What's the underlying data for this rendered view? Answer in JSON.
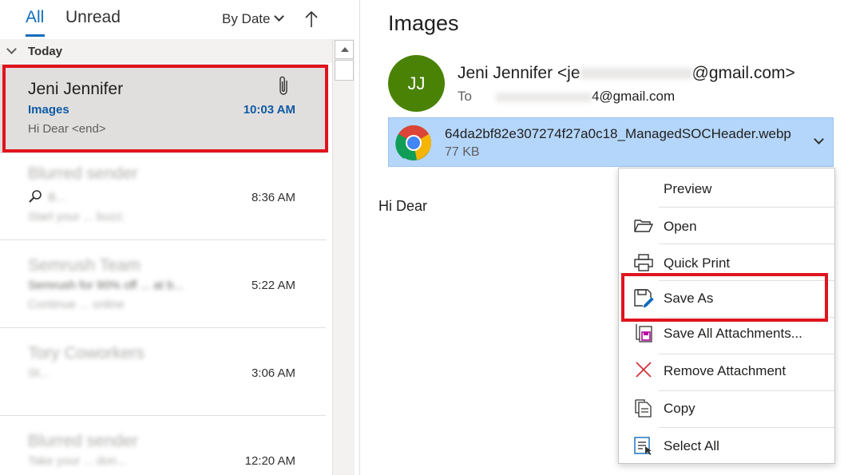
{
  "list_header": {
    "tab_all": "All",
    "tab_unread": "Unread",
    "sort_label": "By Date",
    "sort_direction_icon": "arrow-up-icon"
  },
  "group": {
    "label": "Today"
  },
  "messages": [
    {
      "sender": "Jeni Jennifer",
      "subject": "Images",
      "time": "10:03 AM",
      "preview": "Hi Dear <end>",
      "has_attachment": true,
      "selected": true
    },
    {
      "sender": "Blurred sender",
      "subject": "B...",
      "time": "8:36 AM",
      "preview": "Start your ... buzz:"
    },
    {
      "sender": "Semrush Team",
      "subject": "Semrush for 90% off ... at b...",
      "time": "5:22 AM",
      "preview": "Continue ... online"
    },
    {
      "sender": "Tory Coworkers",
      "subject": "St...",
      "time": "3:06 AM",
      "preview": ""
    },
    {
      "sender": "Blurred sender",
      "subject": "Take your ... don...",
      "time": "12:20 AM",
      "preview": ""
    }
  ],
  "reading": {
    "title": "Images",
    "avatar_initials": "JJ",
    "avatar_color": "#498205",
    "from_name": "Jeni Jennifer <je",
    "from_domain": "@gmail.com>",
    "to_label": "To",
    "to_domain": "4@gmail.com",
    "attachment": {
      "name": "64da2bf82e307274f27a0c18_ManagedSOCHeader.webp",
      "size": "77 KB",
      "icon": "chrome-icon"
    },
    "body": "Hi Dear"
  },
  "context_menu": {
    "items": [
      {
        "label": "Preview",
        "icon": ""
      },
      {
        "label": "Open",
        "icon": "folder-open-icon"
      },
      {
        "label": "Quick Print",
        "icon": "printer-icon"
      },
      {
        "label": "Save As",
        "icon": "save-as-icon"
      },
      {
        "label": "Save All Attachments...",
        "icon": "save-all-icon"
      },
      {
        "label": "Remove Attachment",
        "icon": "close-icon"
      },
      {
        "label": "Copy",
        "icon": "copy-icon"
      },
      {
        "label": "Select All",
        "icon": "select-all-icon"
      }
    ]
  },
  "colors": {
    "accent": "#0f6cbd",
    "highlight": "#e0141d",
    "attachment_bg": "#b4d6fa"
  }
}
